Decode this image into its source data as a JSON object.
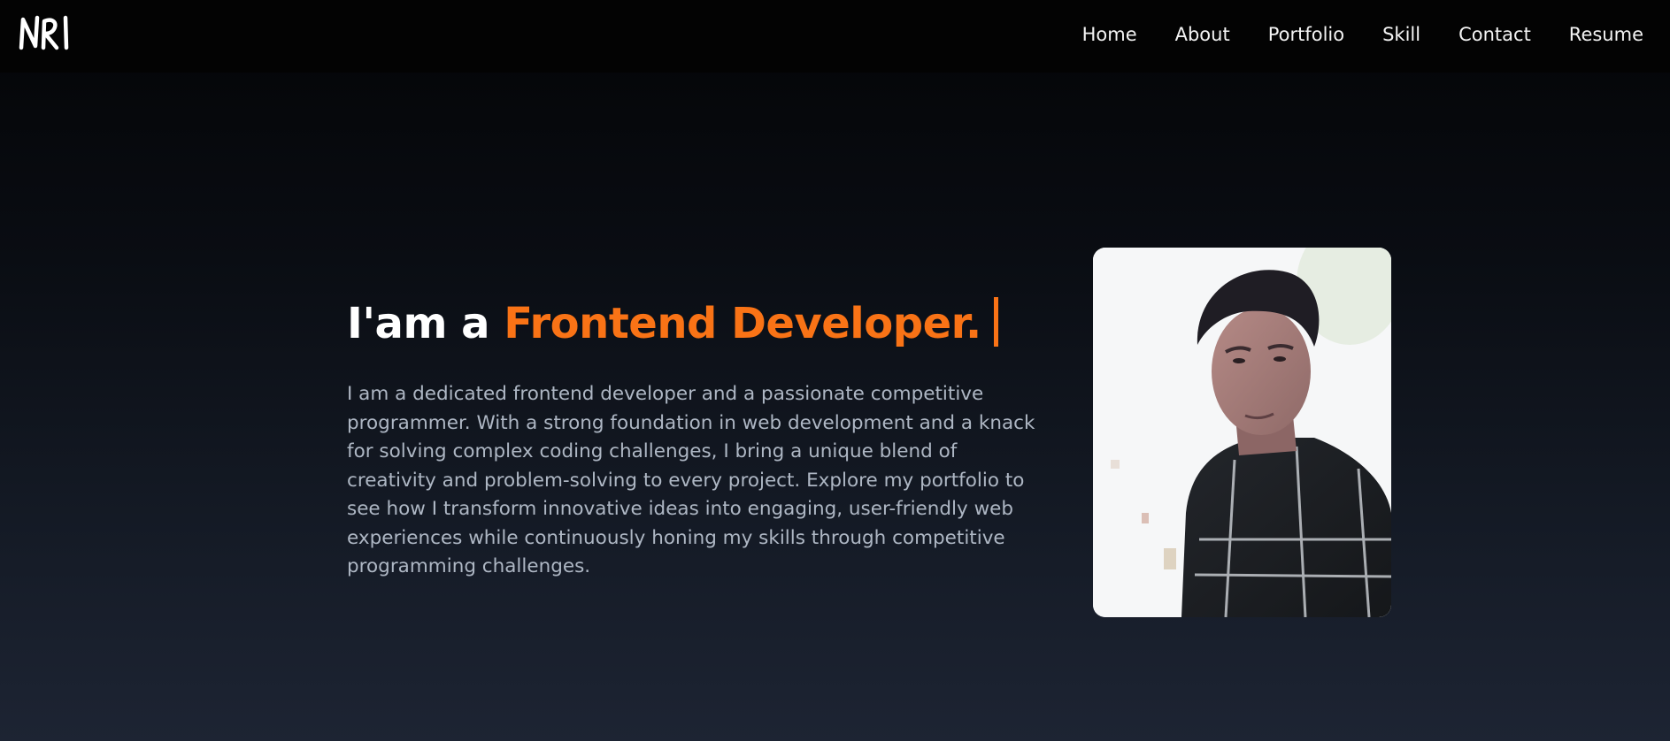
{
  "brand": {
    "logo_text": "NRI",
    "accent_color": "#f97316"
  },
  "nav": {
    "items": [
      {
        "label": "Home"
      },
      {
        "label": "About"
      },
      {
        "label": "Portfolio"
      },
      {
        "label": "Skill"
      },
      {
        "label": "Contact"
      },
      {
        "label": "Resume"
      }
    ]
  },
  "hero": {
    "title_prefix": "I'am a ",
    "title_highlight": "Frontend Developer.",
    "description": "I am a dedicated frontend developer and a passionate competitive programmer. With a strong foundation in web development and a knack for solving complex coding challenges, I bring a unique blend of creativity and problem-solving to every project. Explore my portfolio to see how I transform innovative ideas into engaging, user-friendly web experiences while continuously honing my skills through competitive programming challenges."
  }
}
